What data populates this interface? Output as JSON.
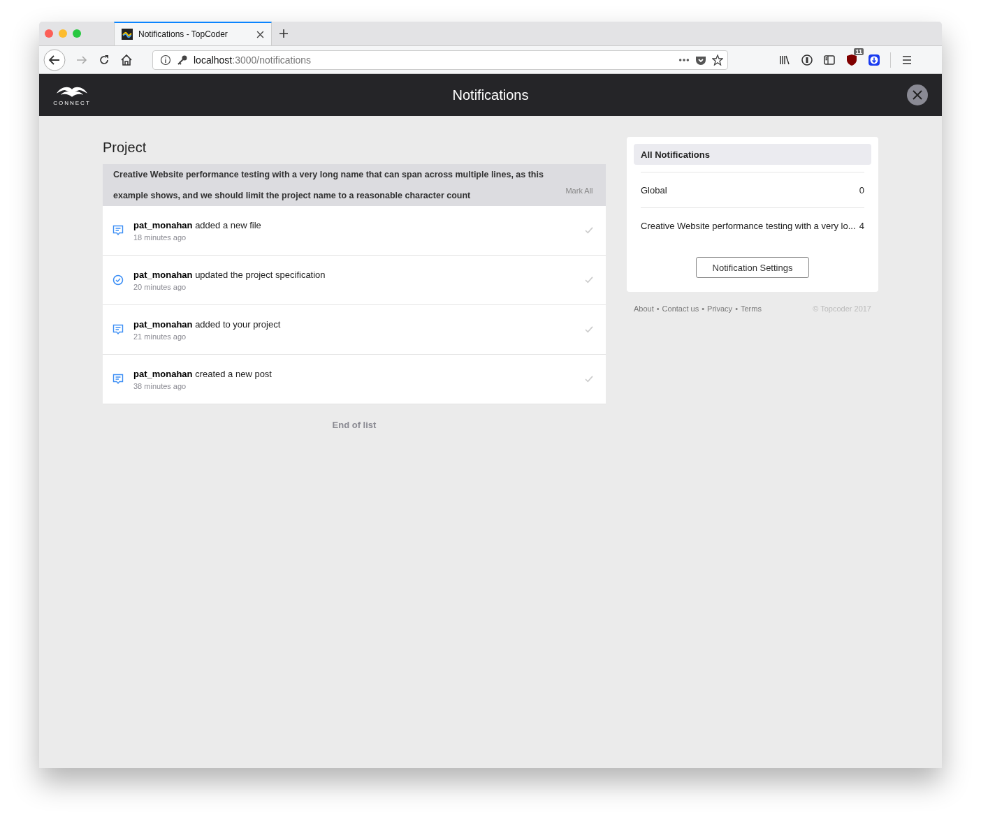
{
  "browser": {
    "tab": {
      "title": "Notifications - TopCoder",
      "selected": true
    },
    "url": {
      "host": "localhost",
      "path": ":3000/notifications"
    },
    "extension_badge": "11"
  },
  "header": {
    "logo_text": "CONNECT",
    "title": "Notifications"
  },
  "project": {
    "heading": "Project",
    "name": "Creative Website performance testing with a very long name that can span across multiple lines, as this example shows, and we should limit the project name to a reasonable character count",
    "mark_all": "Mark All",
    "notifications": [
      {
        "kind": "file",
        "user": "pat_monahan",
        "action": "added a new file",
        "time": "18 minutes ago"
      },
      {
        "kind": "check",
        "user": "pat_monahan",
        "action": "updated the project specification",
        "time": "20 minutes ago"
      },
      {
        "kind": "file",
        "user": "pat_monahan",
        "action": "added to your project",
        "time": "21 minutes ago"
      },
      {
        "kind": "file",
        "user": "pat_monahan",
        "action": "created a new post",
        "time": "38 minutes ago"
      }
    ],
    "end_text": "End of list"
  },
  "sidebar": {
    "items": [
      {
        "label": "All Notifications",
        "selected": true
      },
      {
        "label": "Global",
        "count": "0",
        "selected": false
      },
      {
        "label": "Creative Website performance testing with a very lo...",
        "count": "4",
        "selected": false
      }
    ],
    "settings_button": "Notification Settings"
  },
  "footer": {
    "links": [
      {
        "label": "About"
      },
      {
        "separator": "•",
        "label": "Contact us"
      },
      {
        "separator": "•",
        "label": "Privacy"
      },
      {
        "separator": "•",
        "label": "Terms"
      }
    ],
    "copyright": "© Topcoder 2017"
  }
}
